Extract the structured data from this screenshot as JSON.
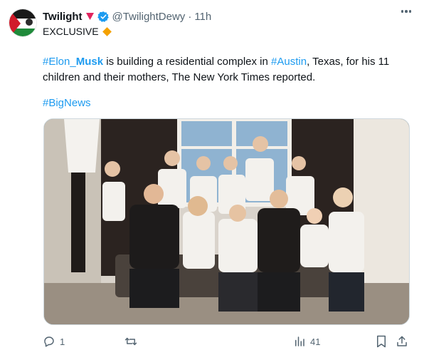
{
  "author": {
    "display_name": "Twilight",
    "handle": "@TwilightDewy",
    "separator": "·",
    "time": "11h"
  },
  "tweet": {
    "label": "EXCLUSIVE",
    "hashtag_elon": "#Elon_",
    "hashtag_musk": "Musk",
    "text_1": " is building a residential complex in ",
    "hashtag_austin": "#Austin",
    "text_2": ", Texas, for his 11 children and their mothers, The New York Times reported.",
    "hashtag_bignews": "#BigNews"
  },
  "actions": {
    "reply_count": "1",
    "retweet_count": "",
    "views_count": "41"
  },
  "icons": {
    "heart": "heart-icon",
    "verified": "verified-badge-icon",
    "more": "more-options-icon",
    "reply": "reply-icon",
    "retweet": "retweet-icon",
    "views": "views-icon",
    "bookmark": "bookmark-icon",
    "share": "share-icon"
  },
  "colors": {
    "accent": "#1d9bf0",
    "heart": "#e0245e",
    "diamond": "#f4a100",
    "muted": "#536471"
  }
}
